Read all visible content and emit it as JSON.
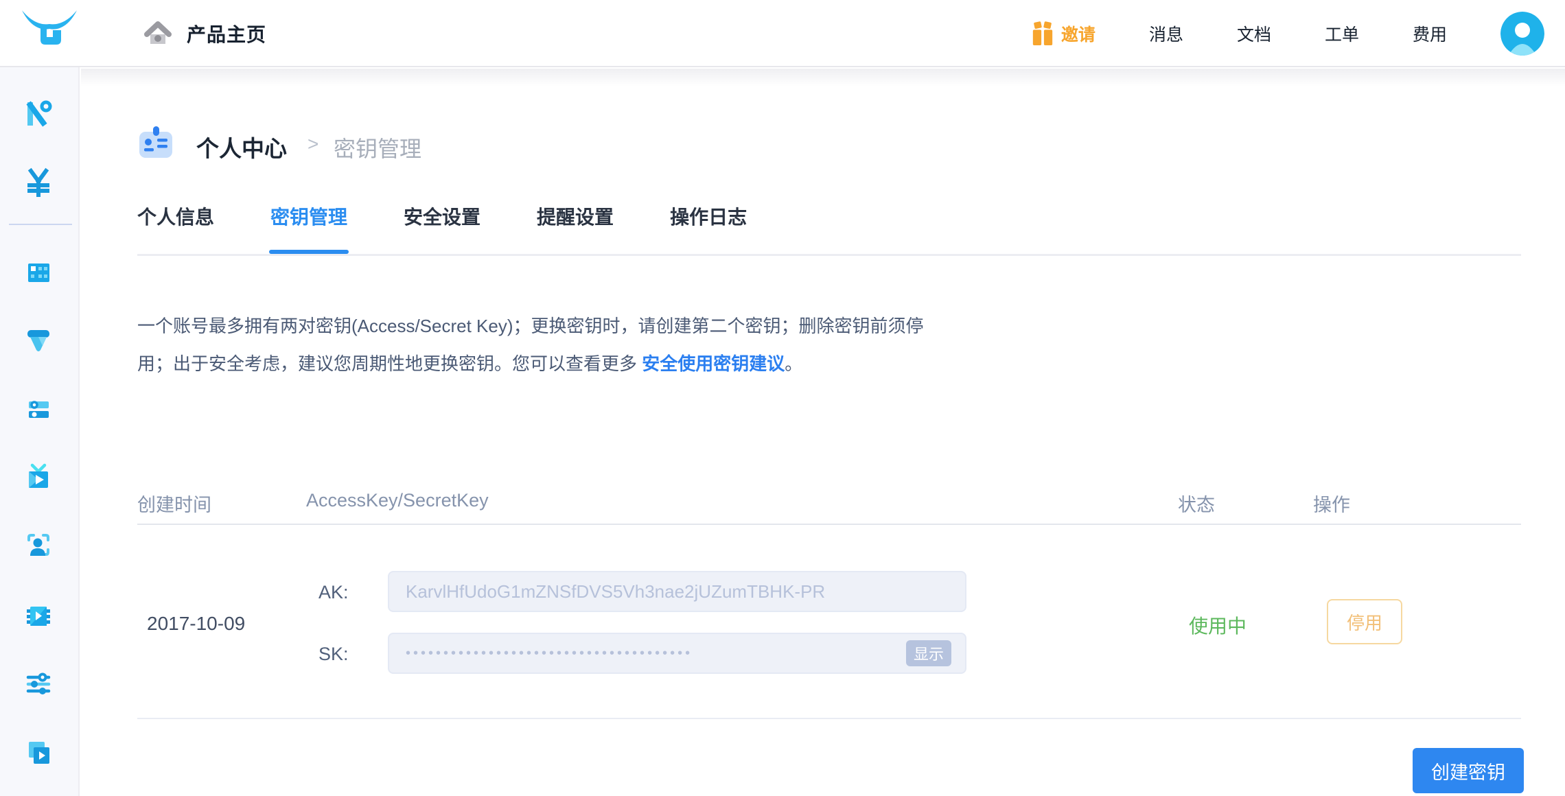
{
  "header": {
    "home_label": "产品主页",
    "nav": [
      {
        "label": "邀请",
        "accent": true
      },
      {
        "label": "消息"
      },
      {
        "label": "文档"
      },
      {
        "label": "工单"
      },
      {
        "label": "费用"
      }
    ]
  },
  "sidebar": {
    "icons": [
      "brand-n",
      "currency-yen",
      "grid-panel",
      "funnel",
      "server-list",
      "media-tv",
      "face-recognition",
      "video-chip",
      "equalizer",
      "video-library"
    ]
  },
  "breadcrumb": {
    "parent": "个人中心",
    "separator": ">",
    "current": "密钥管理"
  },
  "tabs": [
    {
      "label": "个人信息",
      "active": false
    },
    {
      "label": "密钥管理",
      "active": true
    },
    {
      "label": "安全设置",
      "active": false
    },
    {
      "label": "提醒设置",
      "active": false
    },
    {
      "label": "操作日志",
      "active": false
    }
  ],
  "notice": {
    "line1": "一个账号最多拥有两对密钥(Access/Secret Key)；更换密钥时，请创建第二个密钥；删除密钥前须停",
    "line2_prefix": "用；出于安全考虑，建议您周期性地更换密钥。您可以查看更多 ",
    "link_text": "安全使用密钥建议",
    "line2_suffix": "。"
  },
  "table": {
    "headers": [
      "创建时间",
      "AccessKey/SecretKey",
      "状态",
      "操作"
    ],
    "row": {
      "created": "2017-10-09",
      "ak_label": "AK:",
      "ak_value": "KarvlHfUdoG1mZNSfDVS5Vh3nae2jUZumTBHK-PR",
      "sk_label": "SK:",
      "sk_masked": "••••••••••••••••••••••••••••••••••••••",
      "show_button": "显示",
      "status": "使用中",
      "action": "停用"
    }
  },
  "footer": {
    "create_button": "创建密钥"
  },
  "colors": {
    "accent_blue": "#2b8df0",
    "link_blue": "#2b7ff0",
    "invite_orange": "#f7a52d",
    "status_green": "#5cb85c",
    "stop_border": "#f6d8a0",
    "stop_text": "#f2bf77",
    "sidebar_bg": "#f7f8fc",
    "icon_blue": "#1aa7e8"
  }
}
